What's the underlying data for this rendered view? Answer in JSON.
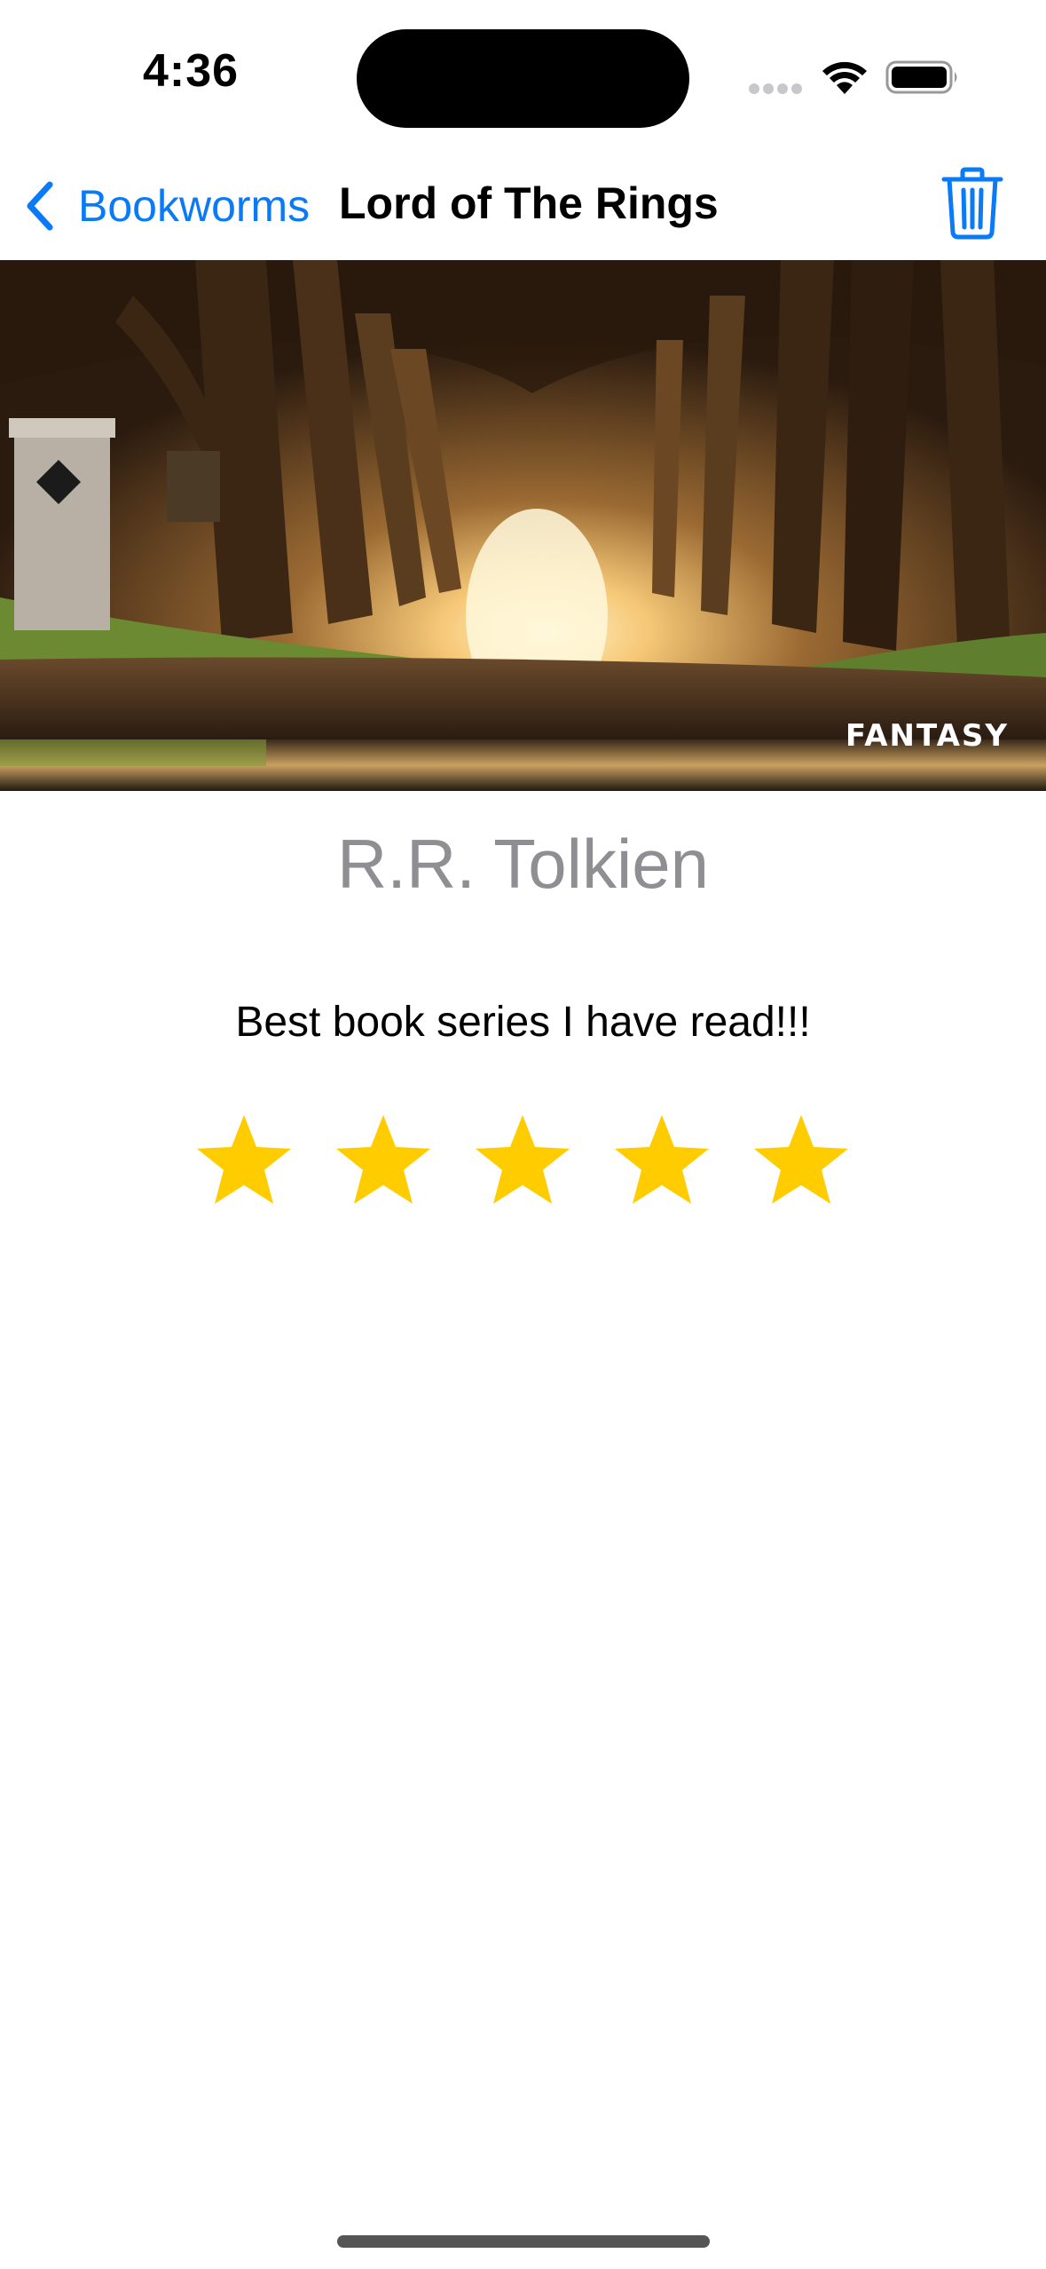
{
  "status_bar": {
    "time": "4:36"
  },
  "nav": {
    "back_label": "Bookworms",
    "title": "Lord of The Rings",
    "back_icon": "chevron-left-icon",
    "trash_icon": "trash-icon"
  },
  "book": {
    "genre": "FANTASY",
    "author": "R.R. Tolkien",
    "review": "Best book series I have read!!!",
    "rating": 5,
    "max_rating": 5
  },
  "colors": {
    "accent": "#0a7af7",
    "star": "#ffcc00",
    "author_text": "#8e8e93"
  }
}
